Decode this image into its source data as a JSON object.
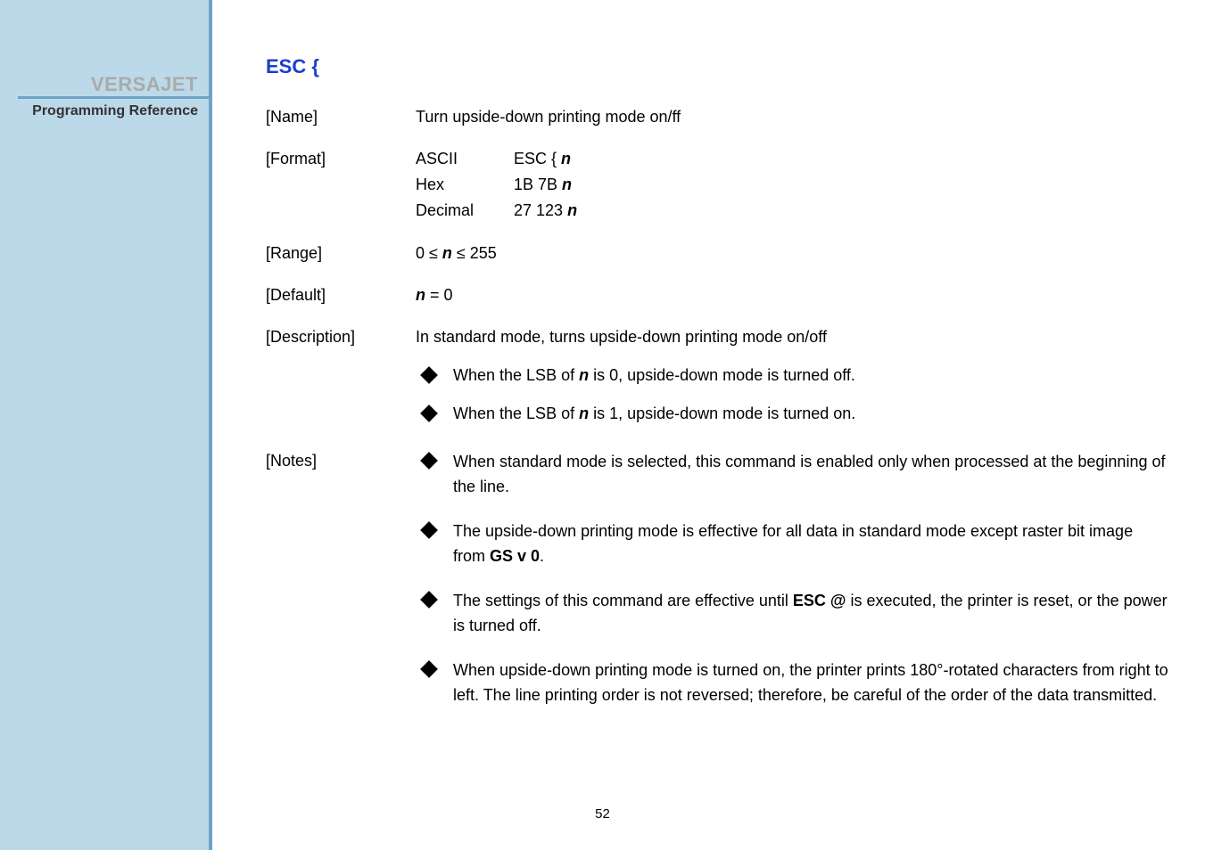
{
  "sidebar": {
    "title": "VERSAJET",
    "subtitle": "Programming Reference"
  },
  "command": {
    "title": "ESC {"
  },
  "sections": {
    "name_label": "[Name]",
    "name_value": "Turn upside-down printing mode on/ff",
    "format_label": "[Format]",
    "format": {
      "ascii_label": "ASCII",
      "ascii_value_pre": "ESC { ",
      "ascii_n": "n",
      "hex_label": "Hex",
      "hex_value_pre": "1B 7B ",
      "hex_n": "n",
      "dec_label": "Decimal",
      "dec_value_pre": "27 123 ",
      "dec_n": "n"
    },
    "range_label": "[Range]",
    "range_pre": "0 ≤ ",
    "range_n": "n",
    "range_post": " ≤ 255",
    "default_label": "[Default]",
    "default_n": "n",
    "default_post": " = 0",
    "description_label": "[Description]",
    "description_value": "In standard mode, turns upside-down printing mode on/off",
    "desc_bullet1_pre": "When the LSB of ",
    "desc_bullet1_n": "n",
    "desc_bullet1_post": " is 0, upside-down mode is turned off.",
    "desc_bullet2_pre": "When the LSB of ",
    "desc_bullet2_n": "n",
    "desc_bullet2_post": " is 1, upside-down mode is turned on.",
    "notes_label": "[Notes]",
    "note1": "When standard mode is selected, this command is enabled only when processed at the beginning of the line.",
    "note2_pre": "The upside-down printing mode is effective for all data in standard mode except raster bit image from ",
    "note2_bold": "GS v 0",
    "note2_post": ".",
    "note3_pre": "The settings of this command are effective until ",
    "note3_bold": "ESC @",
    "note3_post": " is executed, the printer is reset, or the power is turned off.",
    "note4": "When upside-down printing mode is turned on, the printer prints 180°-rotated characters from right to left. The line printing order is not reversed; therefore, be careful of the order of the data transmitted."
  },
  "page_number": "52"
}
